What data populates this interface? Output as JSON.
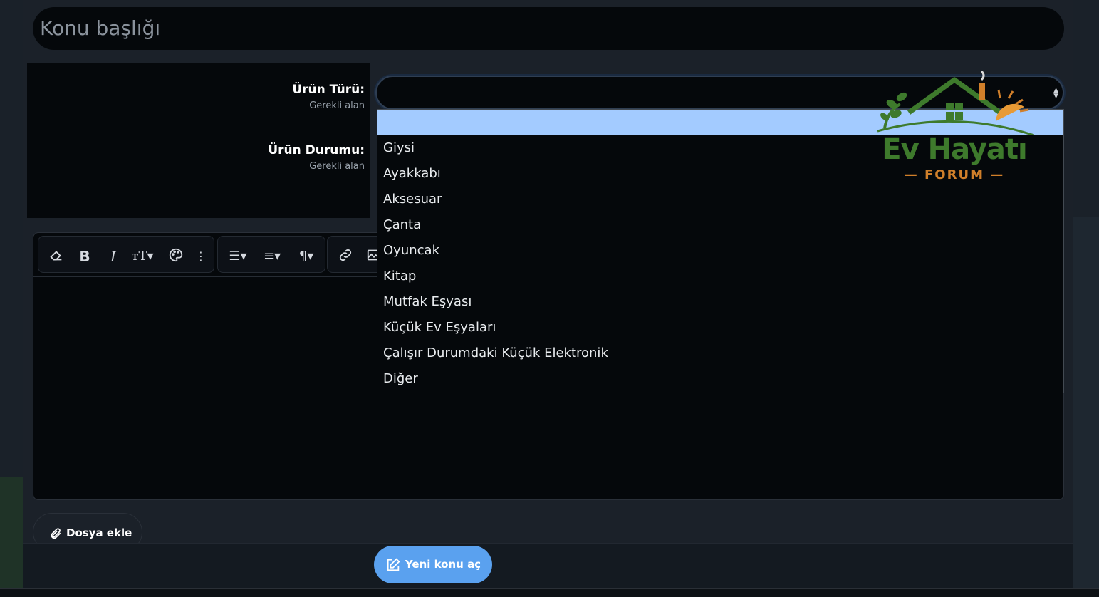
{
  "thread": {
    "title_placeholder": "Konu başlığı"
  },
  "fields": [
    {
      "label": "Ürün Türü:",
      "hint": "Gerekli alan"
    },
    {
      "label": "Ürün Durumu:",
      "hint": "Gerekli alan"
    }
  ],
  "product_type_select": {
    "selected_value": "",
    "options": [
      "",
      "Giysi",
      "Ayakkabı",
      "Aksesuar",
      "Çanta",
      "Oyuncak",
      "Kitap",
      "Mutfak Eşyası",
      "Küçük Ev Eşyaları",
      "Çalışır Durumdaki Küçük Elektronik",
      "Diğer"
    ]
  },
  "editor": {
    "toolbar_icons": [
      "eraser-icon",
      "bold-icon",
      "italic-icon",
      "text-size-icon",
      "palette-icon",
      "more-icon",
      "list-icon",
      "align-icon",
      "paragraph-icon",
      "link-icon",
      "image-icon"
    ]
  },
  "attach": {
    "label": "Dosya ekle"
  },
  "submit": {
    "label": "Yeni konu aç"
  },
  "logo": {
    "title": "Ev Hayatı",
    "subtitle": "FORUM"
  },
  "colors": {
    "accent": "#5aa1ef",
    "highlight": "#a3cbff",
    "logo_green": "#3e7a2c",
    "logo_orange": "#d07f2a"
  }
}
